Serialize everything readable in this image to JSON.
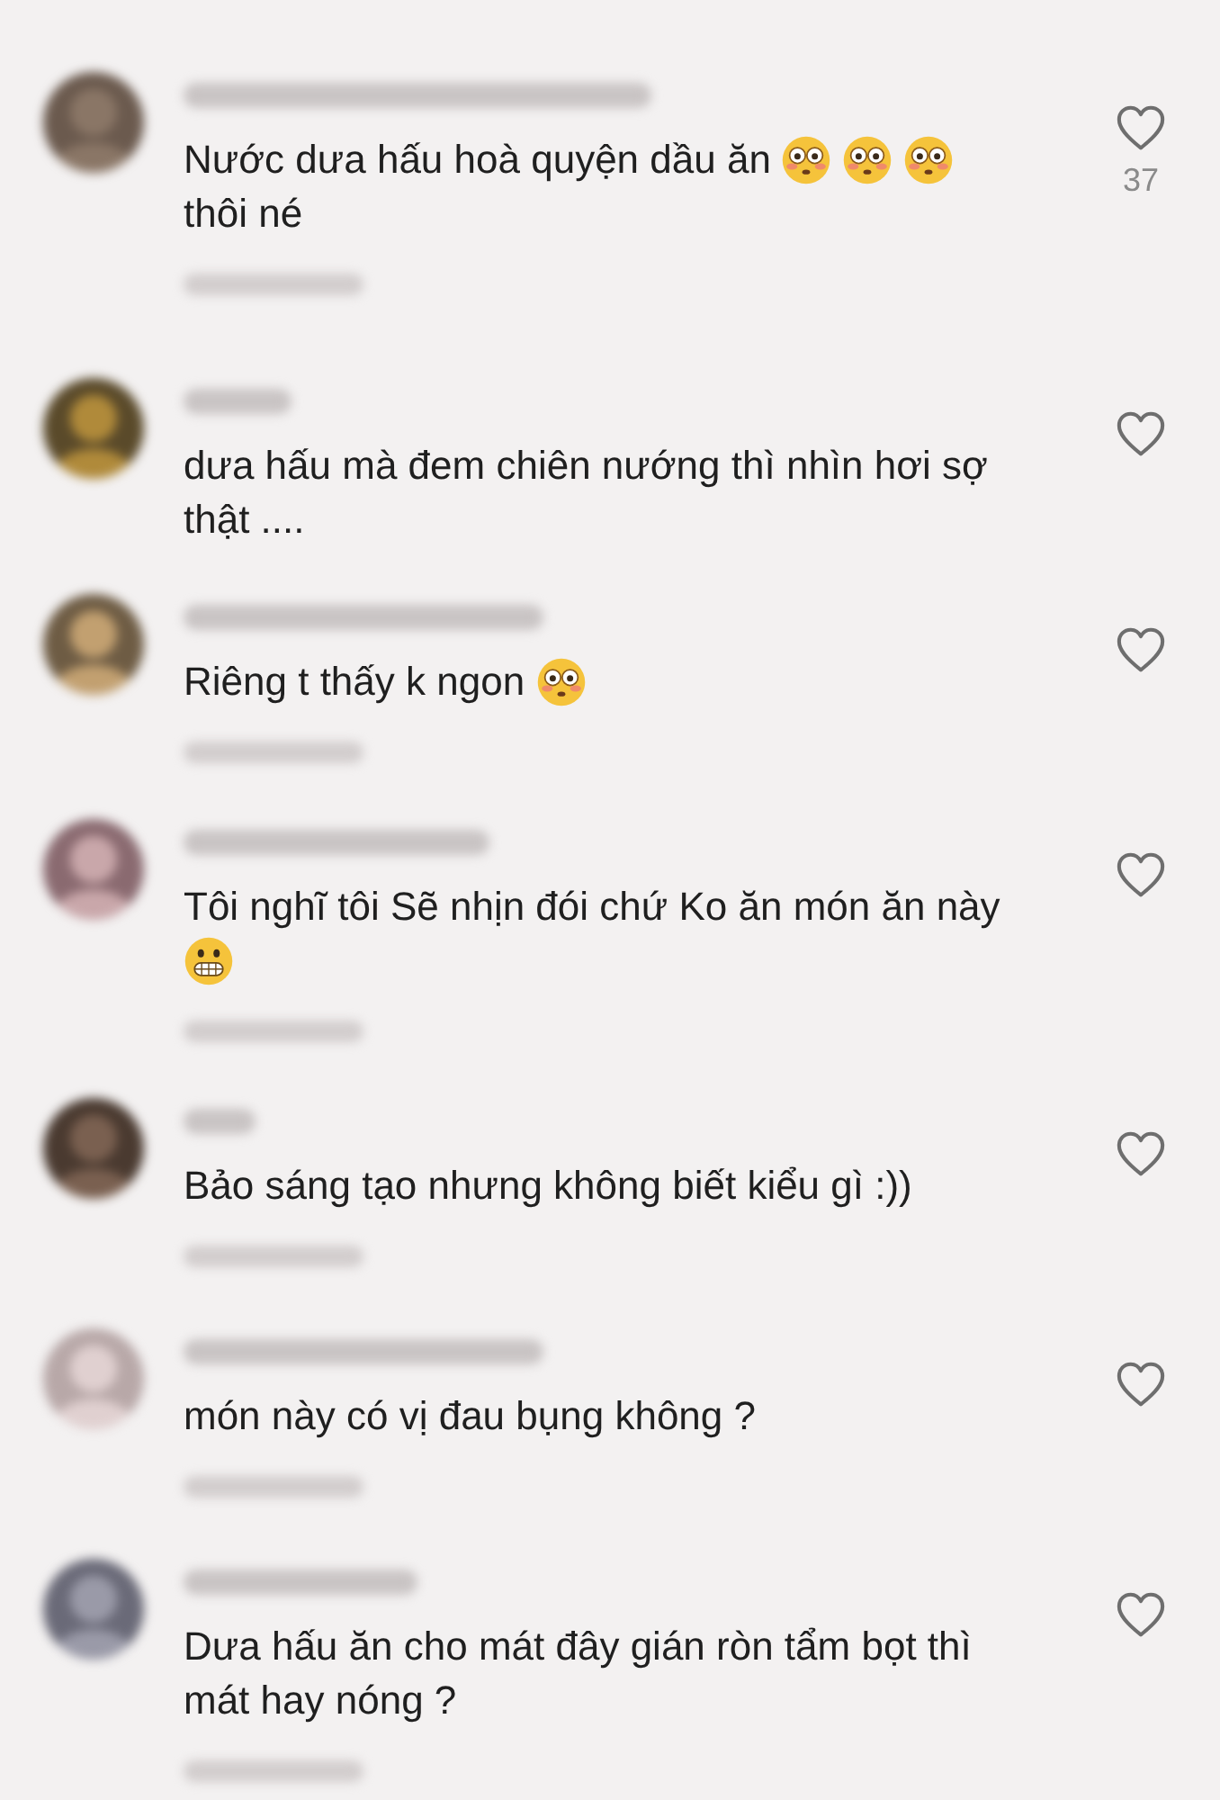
{
  "comments": [
    {
      "meta_visible": true,
      "likes": "37",
      "lines": [
        [
          {
            "kind": "text",
            "text": "Nước dưa hấu hoà quyện dầu ăn"
          },
          {
            "kind": "flushed"
          },
          {
            "kind": "flushed"
          },
          {
            "kind": "flushed"
          }
        ],
        [
          {
            "kind": "text",
            "text": "thôi né"
          }
        ]
      ]
    },
    {
      "meta_visible": false,
      "lines": [
        [
          {
            "kind": "text",
            "text": "dưa hấu mà đem chiên nướng thì nhìn hơi sợ"
          }
        ],
        [
          {
            "kind": "text",
            "text": "thật ...."
          }
        ]
      ]
    },
    {
      "meta_visible": true,
      "lines": [
        [
          {
            "kind": "text",
            "text": "Riêng t thấy k ngon"
          },
          {
            "kind": "flushed"
          }
        ]
      ]
    },
    {
      "meta_visible": true,
      "lines": [
        [
          {
            "kind": "text",
            "text": "Tôi nghĩ tôi Sẽ nhịn đói chứ Ko ăn món ăn này"
          }
        ],
        [
          {
            "kind": "grimacing"
          }
        ]
      ]
    },
    {
      "meta_visible": true,
      "lines": [
        [
          {
            "kind": "text",
            "text": "Bảo sáng tạo nhưng không biết kiểu gì :))"
          }
        ]
      ]
    },
    {
      "meta_visible": true,
      "lines": [
        [
          {
            "kind": "text",
            "text": "món này có vị đau bụng không ?"
          }
        ]
      ]
    },
    {
      "meta_visible": true,
      "lines": [
        [
          {
            "kind": "text",
            "text": "Dưa hấu ăn cho mát đây gián ròn tẩm bọt thì"
          }
        ],
        [
          {
            "kind": "text",
            "text": "mát hay nóng ?"
          }
        ]
      ]
    }
  ]
}
